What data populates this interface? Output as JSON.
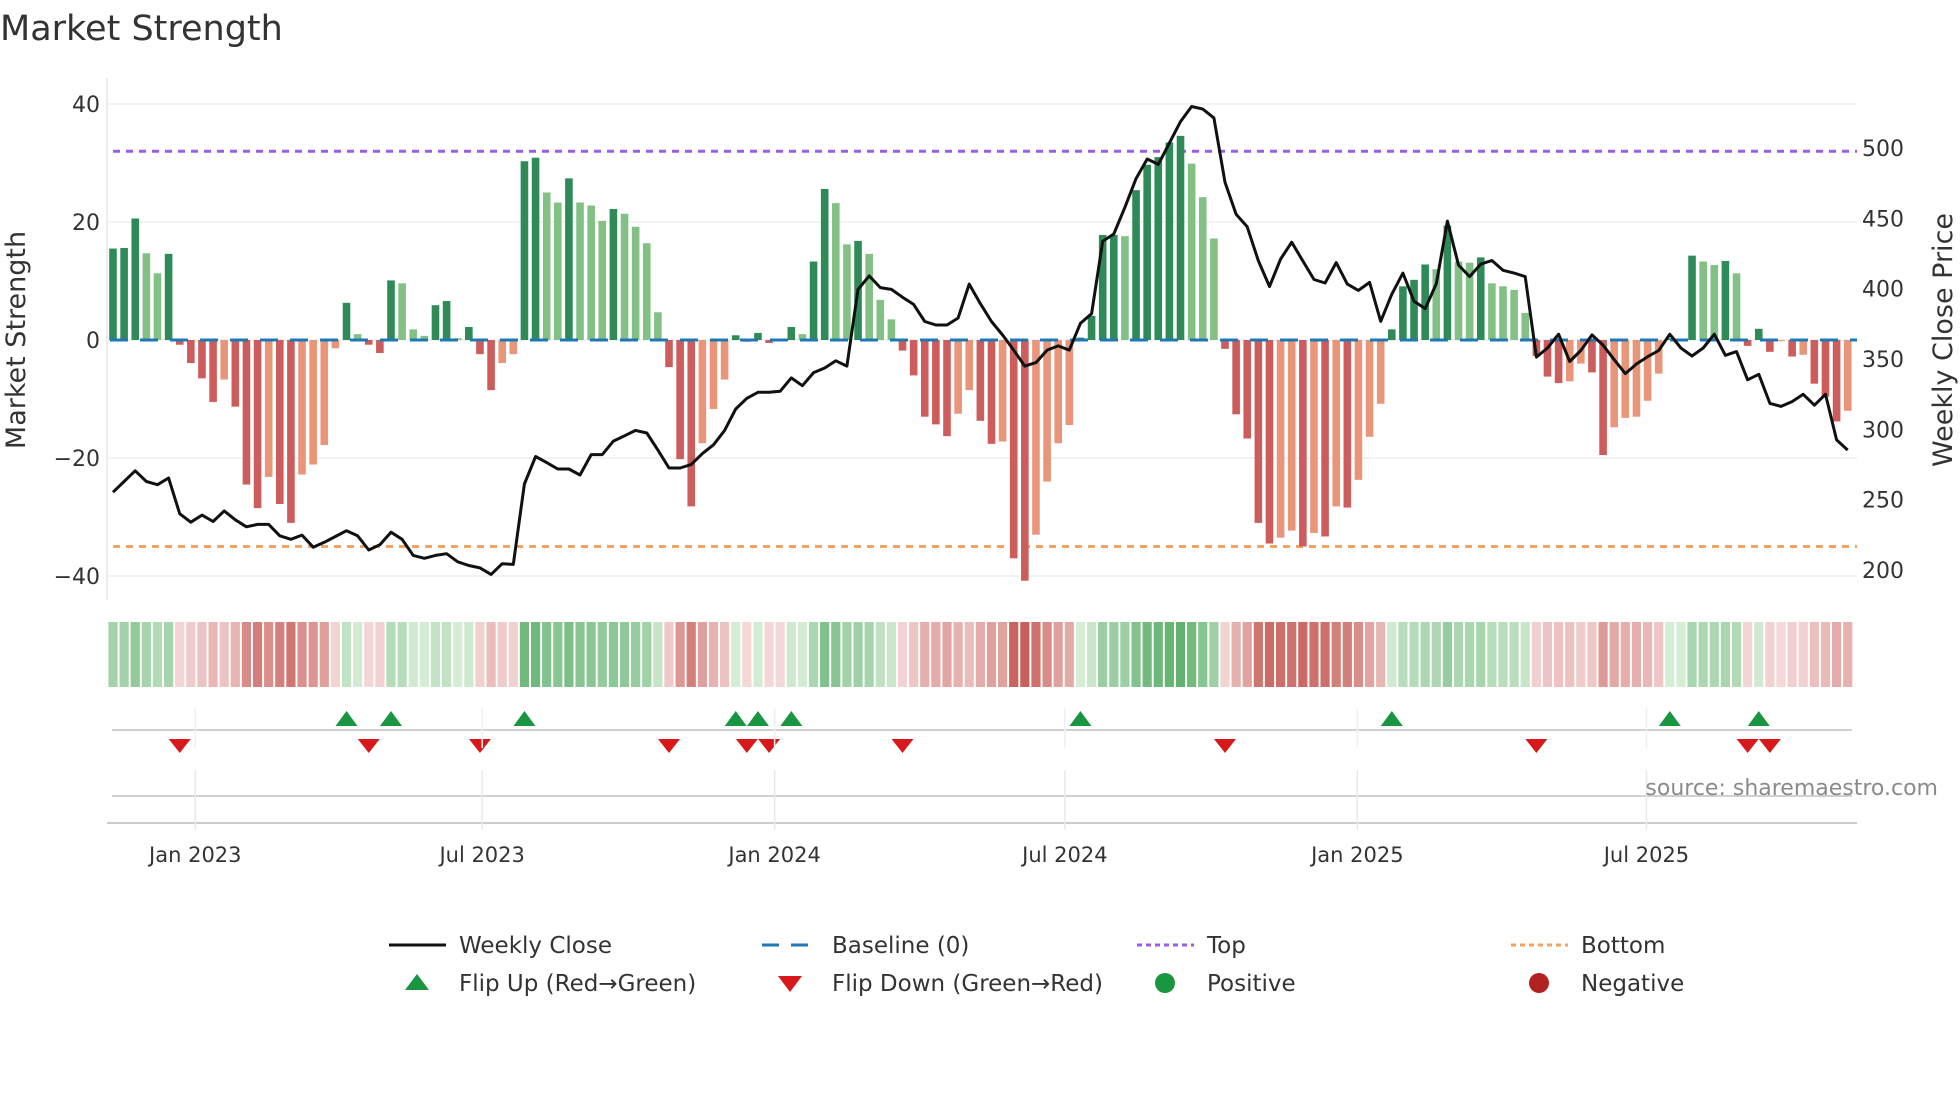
{
  "chart_data": {
    "type": "bar",
    "title": "Market Strength",
    "ylabel": "Market Strength",
    "y2label": "Weekly Close Price",
    "ylim": [
      -44,
      44
    ],
    "y2lim": [
      180,
      540
    ],
    "yticks": [
      40,
      20,
      0,
      -20,
      -40
    ],
    "yticklabels": [
      "40",
      "20",
      "0",
      "−20",
      "−40"
    ],
    "y2ticks": [
      500,
      450,
      400,
      350,
      300,
      250,
      200
    ],
    "y2ticklabels": [
      "500",
      "450",
      "400",
      "350",
      "300",
      "250",
      "200"
    ],
    "x_unit": "week index",
    "xticks": [
      {
        "week": 7.4,
        "label": "Jan 2023"
      },
      {
        "week": 33.2,
        "label": "Jul 2023"
      },
      {
        "week": 59.5,
        "label": "Jan 2024"
      },
      {
        "week": 85.6,
        "label": "Jul 2024"
      },
      {
        "week": 111.9,
        "label": "Jan 2025"
      },
      {
        "week": 137.9,
        "label": "Jul 2025"
      }
    ],
    "top_level": 32,
    "bottom_level": -35,
    "baseline": 0,
    "strength": [
      15.5,
      15.6,
      20.6,
      14.7,
      11.3,
      14.6,
      -0.8,
      -3.9,
      -6.5,
      -10.5,
      -6.7,
      -11.3,
      -24.5,
      -28.5,
      -23.2,
      -27.8,
      -31,
      -22.8,
      -21.1,
      -17.8,
      -1.4,
      6.3,
      1,
      -0.8,
      -2.2,
      10.1,
      9.6,
      1.8,
      0.7,
      5.9,
      6.6,
      0.3,
      2.2,
      -2.4,
      -8.5,
      -3.9,
      -2.4,
      30.3,
      30.9,
      25,
      23.3,
      27.4,
      23.3,
      22.8,
      20.2,
      22.2,
      21.4,
      19.2,
      16.4,
      4.7,
      -4.6,
      -20.2,
      -28.2,
      -17.5,
      -11.7,
      -6.7,
      0.8,
      -0.3,
      1.2,
      -0.5,
      -0.2,
      2.2,
      1,
      13.3,
      25.6,
      23.2,
      16.2,
      16.8,
      14.6,
      6.8,
      3.5,
      -1.8,
      -6,
      -13,
      -14.3,
      -16.3,
      -12.5,
      -8.5,
      -13.7,
      -17.6,
      -17.2,
      -37,
      -40.8,
      -33,
      -24,
      -17.5,
      -14.4,
      0.4,
      4.1,
      17.8,
      17.8,
      17.6,
      25.4,
      29.7,
      31,
      33.5,
      34.6,
      29.9,
      24.2,
      17.2,
      -1.5,
      -12.6,
      -16.7,
      -31,
      -34.5,
      -33.5,
      -32.3,
      -35,
      -32.7,
      -33.3,
      -28.2,
      -28.4,
      -23.7,
      -16.4,
      -10.8,
      1.8,
      9.1,
      10.2,
      12.8,
      12,
      19.4,
      13.3,
      13.1,
      14,
      9.6,
      9.1,
      8.5,
      4.6,
      -2.7,
      -6.2,
      -7.3,
      -7,
      -4,
      -5.5,
      -19.5,
      -14.8,
      -13.2,
      -13,
      -10.3,
      -5.7,
      0.3,
      0.2,
      14.3,
      13.3,
      12.7,
      13.4,
      11.3,
      -1,
      1.9,
      -2,
      -0.2,
      -2.8,
      -2.5,
      -7.4,
      -9.6,
      -13.8,
      -12
    ],
    "weekly_close": [
      255.3,
      262.9,
      270.5,
      262.9,
      260.6,
      265.4,
      240,
      234,
      239,
      234.5,
      242,
      235.7,
      230.7,
      232.4,
      232.4,
      224.3,
      221.8,
      224.8,
      216.2,
      219.7,
      223.8,
      227.9,
      224.3,
      214.2,
      218,
      226.9,
      221.8,
      210.4,
      208.3,
      210.4,
      211.6,
      205.8,
      203.2,
      201.5,
      196.9,
      204.5,
      204,
      261.1,
      280.7,
      276.3,
      271.8,
      271.8,
      267.5,
      282,
      282,
      291.6,
      295.4,
      299.2,
      297.4,
      285.2,
      272.5,
      272.5,
      275,
      282.7,
      289,
      299.2,
      314.4,
      322,
      326.3,
      326.3,
      327.1,
      336.5,
      331,
      340.3,
      343.6,
      348.7,
      344.9,
      399.4,
      409,
      400.7,
      399.4,
      393.9,
      388.8,
      376.6,
      374.1,
      374.1,
      379.1,
      403.2,
      389.3,
      376.6,
      367,
      356.3,
      344.9,
      347.4,
      356.3,
      359.3,
      356.3,
      375.3,
      382.2,
      433.7,
      438.8,
      457.8,
      478.1,
      492.1,
      488.3,
      503.5,
      518.7,
      529.4,
      527.6,
      521.3,
      475.6,
      452.8,
      443.9,
      419.7,
      401.5,
      421,
      433,
      419.7,
      406.5,
      404,
      418.5,
      403.2,
      398.7,
      404.4,
      376.7,
      396,
      411,
      391,
      385.8,
      403.4,
      448,
      416.8,
      408.5,
      417.4,
      420,
      413,
      411,
      408.5,
      351.3,
      357.8,
      367.6,
      348.2,
      356,
      367.1,
      359.8,
      349.5,
      339.6,
      346.4,
      351.6,
      356,
      367.6,
      357.8,
      352.1,
      357.8,
      367.6,
      352.6,
      355.2,
      335.2,
      339.1,
      318.4,
      316.3,
      319.7,
      324.9,
      317.1,
      324.9,
      292.5,
      285.2
    ],
    "legend": {
      "placement": "bottom",
      "entries": [
        {
          "label": "Weekly Close",
          "kind": "line"
        },
        {
          "label": "Baseline (0)",
          "kind": "dashed"
        },
        {
          "label": "Top",
          "kind": "dotted-top"
        },
        {
          "label": "Bottom",
          "kind": "dotted-bottom"
        },
        {
          "label": "Flip Up (Red→Green)",
          "kind": "triangle-up"
        },
        {
          "label": "Flip Down (Green→Red)",
          "kind": "triangle-down"
        },
        {
          "label": "Positive",
          "kind": "circle-pos"
        },
        {
          "label": "Negative",
          "kind": "circle-neg"
        }
      ]
    },
    "colors": {
      "pos_strong": "#2e8b57",
      "pos_weak": "#82c084",
      "neg_strong": "#cd5c5c",
      "neg_weak": "#e8957a",
      "line": "#111111",
      "baseline": "#1f77b4",
      "top": "#9b5de5",
      "bottom": "#f4a261",
      "flip_up": "#1a9641",
      "flip_down": "#d7191c",
      "positive": "#1a9641",
      "negative": "#b22222"
    }
  },
  "source": "source: sharemaestro.com"
}
